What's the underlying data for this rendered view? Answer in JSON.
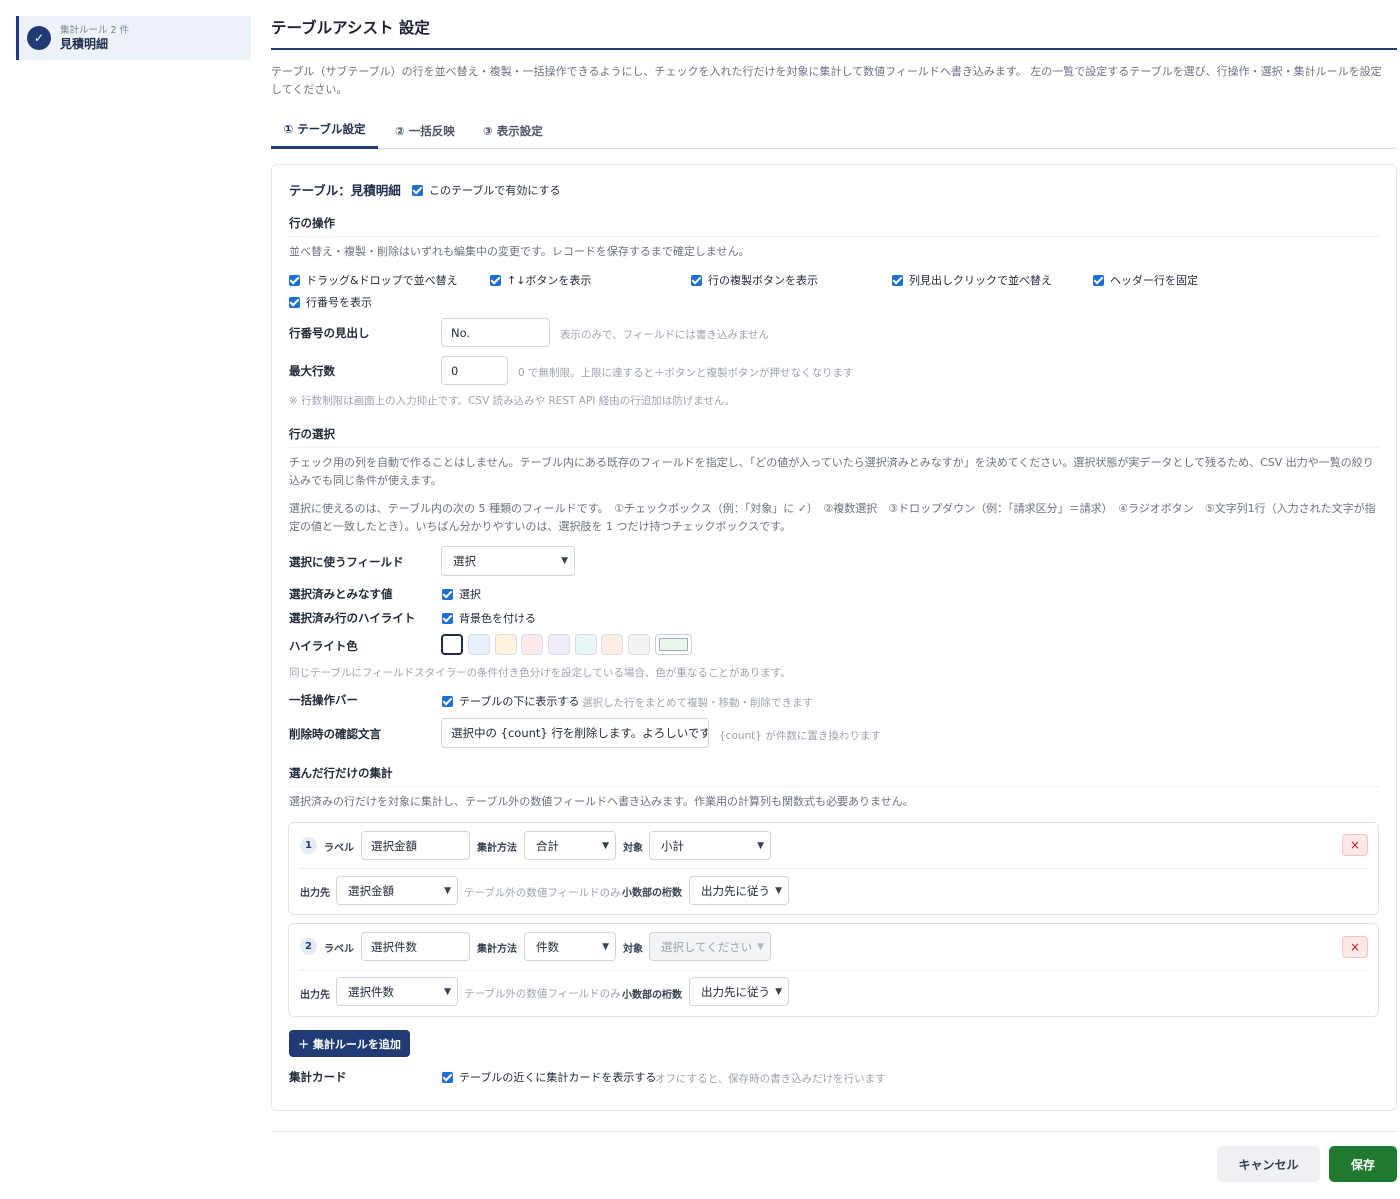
{
  "sidebar": {
    "item": {
      "sub": "集計ルール 2 件",
      "main": "見積明細",
      "icon": "check-circle-icon"
    }
  },
  "header": {
    "title": "テーブルアシスト 設定",
    "description": "テーブル（サブテーブル）の行を並べ替え・複製・一括操作できるようにし、チェックを入れた行だけを対象に集計して数値フィールドへ書き込みます。 左の一覧で設定するテーブルを選び、行操作・選択・集計ルールを設定してください。"
  },
  "tabs": [
    {
      "label": "① テーブル設定",
      "active": true
    },
    {
      "label": "② 一括反映",
      "active": false
    },
    {
      "label": "③ 表示設定",
      "active": false
    }
  ],
  "table": {
    "title": "テーブル：見積明細",
    "enable_label": "このテーブルで有効にする",
    "enabled": true
  },
  "row_ops": {
    "title": "行の操作",
    "note": "並べ替え・複製・削除はいずれも編集中の変更です。レコードを保存するまで確定しません。",
    "options": [
      {
        "label": "ドラッグ&ドロップで並べ替え",
        "checked": true
      },
      {
        "label": "↑↓ボタンを表示",
        "checked": true
      },
      {
        "label": "行の複製ボタンを表示",
        "checked": true
      },
      {
        "label": "列見出しクリックで並べ替え",
        "checked": true
      },
      {
        "label": "ヘッダー行を固定",
        "checked": true
      },
      {
        "label": "行番号を表示",
        "checked": true
      }
    ],
    "rownum_heading": {
      "label": "行番号の見出し",
      "value": "No.",
      "hint": "表示のみで、フィールドには書き込みません"
    },
    "max_rows": {
      "label": "最大行数",
      "value": "0",
      "hint": "0 で無制限。上限に達すると＋ボタンと複製ボタンが押せなくなります"
    },
    "footnote": "※ 行数制限は画面上の入力抑止です。CSV 読み込みや REST API 経由の行追加は防げません。"
  },
  "selection": {
    "title": "行の選択",
    "note1": "チェック用の列を自動で作ることはしません。テーブル内にある既存のフィールドを指定し、「どの値が入っていたら選択済みとみなすか」を決めてください。選択状態が実データとして残るため、CSV 出力や一覧の絞り込みでも同じ条件が使えます。",
    "note2": "選択に使えるのは、テーブル内の次の 5 種類のフィールドです。　①チェックボックス（例：「対象」に ✓）　②複数選択　③ドロップダウン（例：「請求区分」＝請求）　④ラジオボタン　⑤文字列1行（入力された文字が指定の値と一致したとき）。いちばん分かりやすいのは、選択肢を 1 つだけ持つチェックボックスです。",
    "field": {
      "label": "選択に使うフィールド",
      "value": "選択"
    },
    "selected_value": {
      "label": "選択済みとみなす値",
      "option": "選択",
      "checked": true
    },
    "highlight": {
      "label": "選択済み行のハイライト",
      "option": "背景色を付ける",
      "checked": true
    },
    "highlight_color": {
      "label": "ハイライト色",
      "swatches": [
        "#ffffff",
        "#e8f0fe",
        "#fff4e0",
        "#fde8ea",
        "#f1ebfb",
        "#e6f7f5",
        "#fdeee4",
        "#f1f3f5",
        "#e9f6ea"
      ],
      "selected_index": 0,
      "note": "同じテーブルにフィールドスタイラーの条件付き色分けを設定している場合、色が重なることがあります。"
    },
    "bulk_bar": {
      "label": "一括操作バー",
      "option": "テーブルの下に表示する",
      "checked": true,
      "hint": "選択した行をまとめて複製・移動・削除できます"
    },
    "delete_confirm": {
      "label": "削除時の確認文言",
      "value": "選択中の {count} 行を削除します。よろしいですか？",
      "hint": "{count} が件数に置き換わります"
    }
  },
  "aggregate": {
    "title": "選んだ行だけの集計",
    "note": "選択済みの行だけを対象に集計し、テーブル外の数値フィールドへ書き込みます。作業用の計算列も関数式も必要ありません。",
    "labels": {
      "label": "ラベル",
      "method": "集計方法",
      "target": "対象",
      "output": "出力先",
      "output_hint": "テーブル外の数値フィールドのみ",
      "decimals": "小数部の桁数"
    },
    "rules": [
      {
        "no": "1",
        "label": "選択金額",
        "method": "合計",
        "target": "小計",
        "target_disabled": false,
        "output": "選択金額",
        "decimals": "出力先に従う"
      },
      {
        "no": "2",
        "label": "選択件数",
        "method": "件数",
        "target": "選択してください",
        "target_disabled": true,
        "output": "選択件数",
        "decimals": "出力先に従う"
      }
    ],
    "add_button": "＋ 集計ルールを追加",
    "card": {
      "label": "集計カード",
      "option": "テーブルの近くに集計カードを表示する",
      "checked": true,
      "hint": "オフにすると、保存時の書き込みだけを行います"
    }
  },
  "footer": {
    "cancel": "キャンセル",
    "save": "保存"
  }
}
